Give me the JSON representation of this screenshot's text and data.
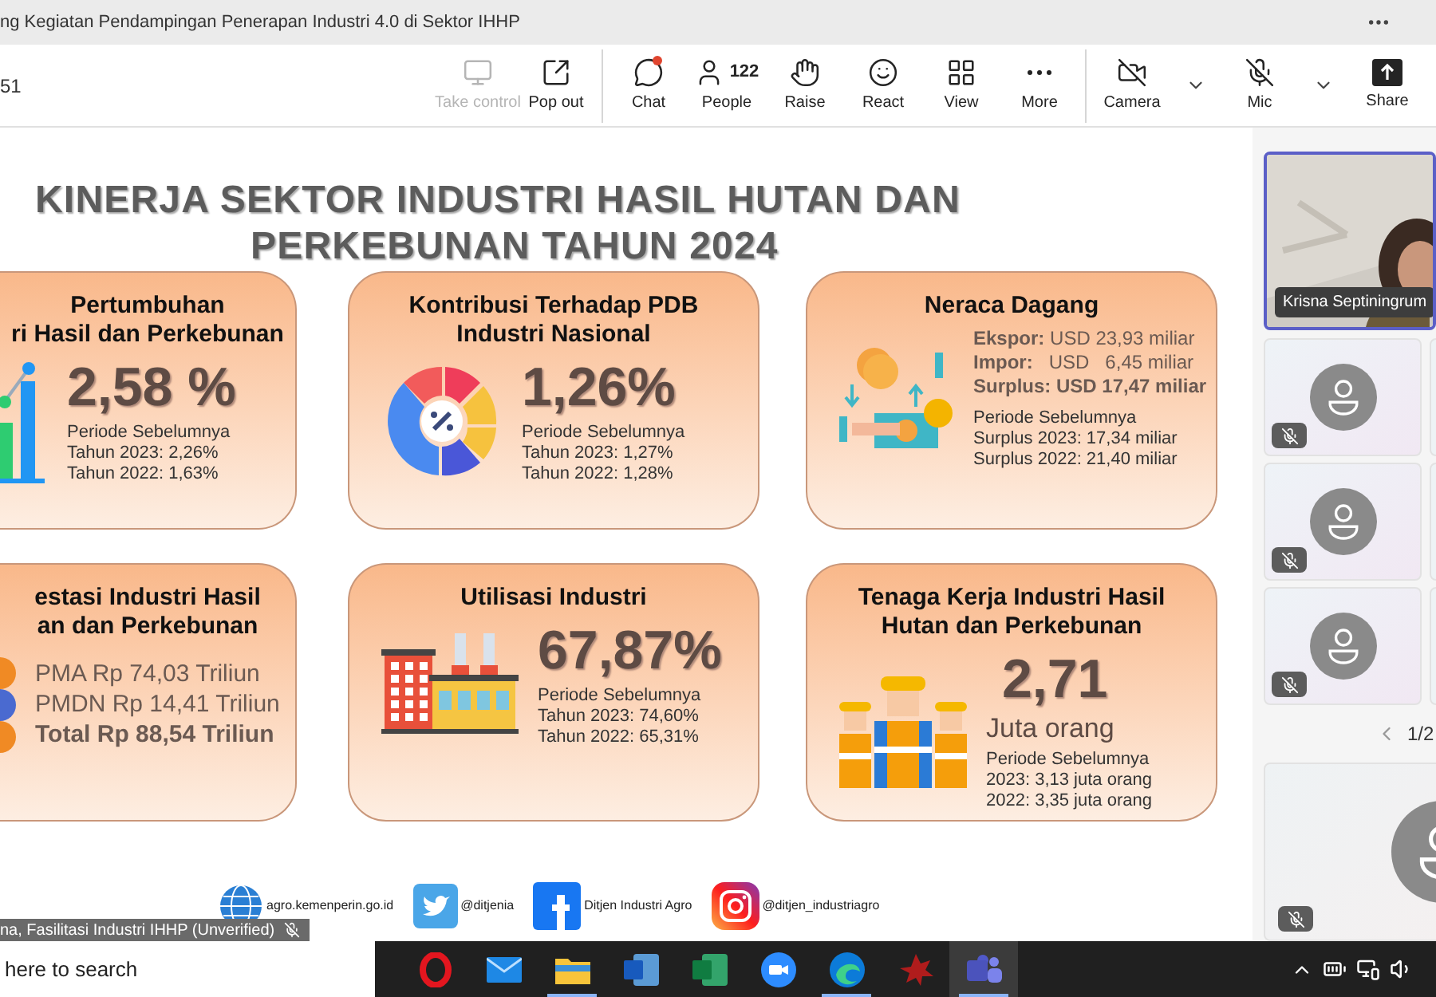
{
  "title_bar": {
    "title": "ng Kegiatan Pendampingan Penerapan Industri 4.0 di Sektor IHHP"
  },
  "toolbar": {
    "meeting_time": "51",
    "groups": [
      [
        {
          "kind": "take_control",
          "label": "Take control",
          "disabled": true
        },
        {
          "kind": "pop_out",
          "label": "Pop out",
          "disabled": false
        }
      ],
      [
        {
          "kind": "chat",
          "label": "Chat",
          "disabled": false,
          "unread": true
        },
        {
          "kind": "people",
          "label": "People",
          "count": "122",
          "disabled": false
        },
        {
          "kind": "raise",
          "label": "Raise",
          "disabled": false
        },
        {
          "kind": "react",
          "label": "React",
          "disabled": false
        },
        {
          "kind": "view",
          "label": "View",
          "disabled": false
        },
        {
          "kind": "more",
          "label": "More",
          "disabled": false
        }
      ],
      [
        {
          "kind": "camera",
          "label": "Camera",
          "off": true,
          "disabled": false
        },
        {
          "kind": "mic",
          "label": "Mic",
          "off": true,
          "disabled": false
        },
        {
          "kind": "share",
          "label": "Share",
          "disabled": false
        }
      ]
    ]
  },
  "slide": {
    "title_lines": [
      "KINERJA SEKTOR INDUSTRI HASIL HUTAN DAN",
      "PERKEBUNAN TAHUN 2024"
    ],
    "cards": [
      {
        "kind": "growth",
        "title_lines": [
          "Pertumbuhan",
          "ri Hasil dan Perkebunan"
        ],
        "value": "2,58 %",
        "previous": [
          "Periode Sebelumnya",
          "Tahun 2023: 2,26%",
          "Tahun 2022: 1,63%"
        ]
      },
      {
        "kind": "share",
        "title_lines": [
          "Kontribusi Terhadap PDB",
          "Industri Nasional"
        ],
        "value": "1,26%",
        "previous": [
          "Periode Sebelumnya",
          "Tahun 2023: 1,27%",
          "Tahun 2022: 1,28%"
        ]
      },
      {
        "kind": "trade",
        "title_lines": [
          "Neraca Dagang"
        ],
        "facts": [
          {
            "text": "**Ekspor:** USD 23,93 miliar",
            "bold": false
          },
          {
            "text": "**Impor:**   USD   6,45 miliar",
            "bold": false
          },
          {
            "text": "Surplus: USD 17,47 miliar",
            "bold": true
          }
        ],
        "previous": [
          "Periode Sebelumnya",
          "Surplus 2023: 17,34 miliar",
          "Surplus 2022: 21,40 miliar"
        ]
      },
      {
        "kind": "investment",
        "title_lines": [
          "estasi Industri Hasil",
          "an dan Perkebunan"
        ],
        "facts": [
          {
            "text": "PMA Rp 74,03 Triliun",
            "bold": false
          },
          {
            "text": "PMDN Rp 14,41 Triliun",
            "bold": false
          },
          {
            "text": "Total Rp 88,54 Triliun",
            "bold": true
          }
        ]
      },
      {
        "kind": "utilization",
        "title_lines": [
          "Utilisasi Industri"
        ],
        "value": "67,87%",
        "previous": [
          "Periode Sebelumnya",
          "Tahun 2023: 74,60%",
          "Tahun 2022: 65,31%"
        ]
      },
      {
        "kind": "workforce",
        "title_lines": [
          "Tenaga Kerja Industri Hasil",
          "Hutan dan Perkebunan"
        ],
        "value": "2,71",
        "value_note": "Juta orang",
        "previous": [
          "Periode Sebelumnya",
          "2023: 3,13 juta orang",
          "2022: 3,35 juta orang"
        ]
      }
    ],
    "footer": [
      {
        "kind": "web",
        "text": "agro.kemenperin.go.id"
      },
      {
        "kind": "bird",
        "text": "@ditjenia"
      },
      {
        "kind": "f_logo",
        "text": "Ditjen Industri Agro"
      },
      {
        "kind": "camera_logo",
        "text": "@ditjen_industriagro"
      }
    ]
  },
  "presenter_label": {
    "name": "na, Fasilitasi Industri IHHP (Unverified)",
    "muted": true
  },
  "participants": {
    "featured": {
      "name": "Krisna Septiningrum"
    },
    "tiles": [
      {
        "muted": true
      },
      {
        "muted": true
      },
      {
        "muted": true
      }
    ],
    "pager": "1/2",
    "bottom_tile": {
      "muted": true
    }
  },
  "taskbar": {
    "search": {
      "placeholder": "here to search"
    },
    "apps": [
      {
        "kind": "ring",
        "running": false,
        "selected": false
      },
      {
        "kind": "mail",
        "running": false,
        "selected": false
      },
      {
        "kind": "folder",
        "running": true,
        "selected": false
      },
      {
        "kind": "doc",
        "running": false,
        "selected": false
      },
      {
        "kind": "sheet",
        "running": false,
        "selected": false
      },
      {
        "kind": "video_call",
        "running": false,
        "selected": false
      },
      {
        "kind": "wave",
        "running": true,
        "selected": false
      },
      {
        "kind": "splat",
        "running": false,
        "selected": false
      },
      {
        "kind": "team",
        "running": true,
        "selected": true
      }
    ]
  }
}
